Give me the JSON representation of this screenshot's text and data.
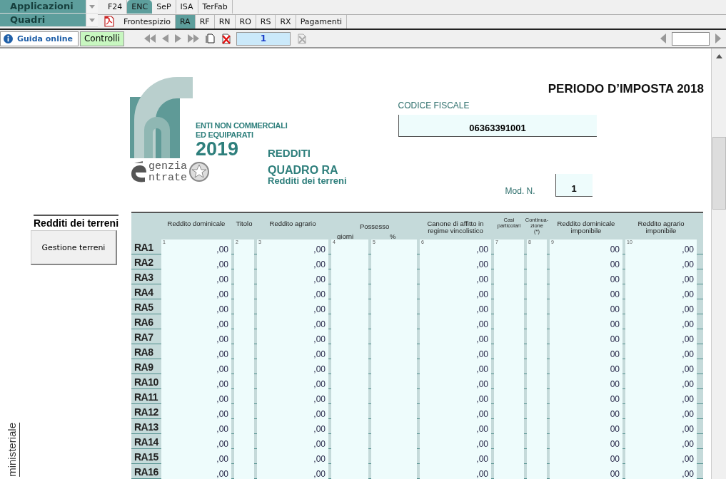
{
  "selectors": [
    {
      "label": "Applicazioni"
    },
    {
      "label": "Quadri"
    }
  ],
  "app_tabs": [
    {
      "label": "F24",
      "selected": false
    },
    {
      "label": "ENC",
      "selected": true
    },
    {
      "label": "SeP",
      "selected": false
    },
    {
      "label": "ISA",
      "selected": false
    },
    {
      "label": "TerFab",
      "selected": false
    }
  ],
  "section_tabs": [
    {
      "label": "Frontespizio",
      "selected": false
    },
    {
      "label": "RA",
      "selected": true
    },
    {
      "label": "RF",
      "selected": false
    },
    {
      "label": "RN",
      "selected": false
    },
    {
      "label": "RO",
      "selected": false
    },
    {
      "label": "RS",
      "selected": false
    },
    {
      "label": "RX",
      "selected": false
    },
    {
      "label": "Pagamenti",
      "selected": false
    }
  ],
  "toolbar": {
    "help_button": "Guida online",
    "check_button": "Controlli",
    "page_number": "1"
  },
  "form": {
    "logo": {
      "line_1": "ENTI NON COMMERCIALI",
      "line_2": "ED EQUIPARATI",
      "year": "2019",
      "agency_1": "genzia",
      "agency_2": "ntrate"
    },
    "section": "REDDITI",
    "quadro": "QUADRO RA",
    "subtitle": "Redditi dei terreni",
    "period": "PERIODO D’IMPOSTA 2018",
    "tax_code_label": "CODICE FISCALE",
    "tax_code": "06363391001",
    "module_label": "Mod. N.",
    "module_number": "1"
  },
  "sidebar": {
    "title": "Redditi dei terreni",
    "button": "Gestione terreni",
    "vertical_label": "ministeriale"
  },
  "table": {
    "possession_group": "Possesso",
    "columns": [
      {
        "header": "Reddito dominicale",
        "number": "1",
        "kind": "amount"
      },
      {
        "header": "Titolo",
        "number": "2",
        "kind": "code"
      },
      {
        "header": "Reddito agrario",
        "number": "3",
        "kind": "amount"
      },
      {
        "header": "giorni",
        "number": "4",
        "kind": "code"
      },
      {
        "header": "%",
        "number": "5",
        "kind": "code"
      },
      {
        "header": "Canone di affitto in\nregime vincolistico",
        "number": "6",
        "kind": "amount"
      },
      {
        "header": "Casi\nparticolari",
        "number": "7",
        "kind": "code"
      },
      {
        "header": "Continua-\nzione\n(*)",
        "number": "8",
        "kind": "code"
      },
      {
        "header": "Reddito dominicale\nimponibile",
        "number": "9",
        "kind": "amount"
      },
      {
        "header": "Reddito agrario\nimponibile",
        "number": "10",
        "kind": "amount"
      }
    ],
    "rows": [
      {
        "label": "RA1",
        "amounts": [
          ",00",
          ",00",
          ",00",
          "00",
          ",00"
        ]
      },
      {
        "label": "RA2",
        "amounts": [
          ",00",
          ",00",
          ",00",
          "00",
          ",00"
        ]
      },
      {
        "label": "RA3",
        "amounts": [
          ",00",
          ",00",
          ",00",
          "00",
          ",00"
        ]
      },
      {
        "label": "RA4",
        "amounts": [
          ",00",
          ",00",
          ",00",
          "00",
          ",00"
        ]
      },
      {
        "label": "RA5",
        "amounts": [
          ",00",
          ",00",
          ",00",
          "00",
          ",00"
        ]
      },
      {
        "label": "RA6",
        "amounts": [
          ",00",
          ",00",
          ",00",
          "00",
          ",00"
        ]
      },
      {
        "label": "RA7",
        "amounts": [
          ",00",
          ",00",
          ",00",
          "00",
          ",00"
        ]
      },
      {
        "label": "RA8",
        "amounts": [
          ",00",
          ",00",
          ",00",
          "00",
          ",00"
        ]
      },
      {
        "label": "RA9",
        "amounts": [
          ",00",
          ",00",
          ",00",
          "00",
          ",00"
        ]
      },
      {
        "label": "RA10",
        "amounts": [
          ",00",
          ",00",
          ",00",
          "00",
          ",00"
        ]
      },
      {
        "label": "RA11",
        "amounts": [
          ",00",
          ",00",
          ",00",
          "00",
          ",00"
        ]
      },
      {
        "label": "RA12",
        "amounts": [
          ",00",
          ",00",
          ",00",
          "00",
          ",00"
        ]
      },
      {
        "label": "RA13",
        "amounts": [
          ",00",
          ",00",
          ",00",
          "00",
          ",00"
        ]
      },
      {
        "label": "RA14",
        "amounts": [
          ",00",
          ",00",
          ",00",
          "00",
          ",00"
        ]
      },
      {
        "label": "RA15",
        "amounts": [
          ",00",
          ",00",
          ",00",
          "00",
          ",00"
        ]
      },
      {
        "label": "RA16",
        "amounts": [
          ",00",
          ",00",
          ",00",
          "00",
          ",00"
        ]
      }
    ]
  }
}
